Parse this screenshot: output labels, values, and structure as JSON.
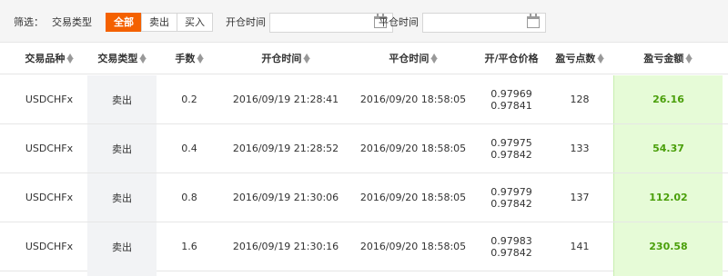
{
  "filter": {
    "label": "筛选：",
    "type_label": "交易类型",
    "type_options": [
      "全部",
      "卖出",
      "买入"
    ],
    "open_time_label": "开仓时间",
    "open_time_value": "",
    "close_time_label": "平仓时间",
    "close_time_value": "",
    "calendar_icon": "calendar-icon"
  },
  "table": {
    "headers": [
      "交易品种",
      "交易类型",
      "手数",
      "开仓时间",
      "平仓时间",
      "开/平仓价格",
      "盈亏点数",
      "盈亏金额"
    ],
    "sort_icon": "sort-icon",
    "rows": [
      {
        "symbol": "USDCHFx",
        "type": "卖出",
        "lots": "0.2",
        "open_time": "2016/09/19 21:28:41",
        "close_time": "2016/09/20 18:58:05",
        "open_price": "0.97969",
        "close_price": "0.97841",
        "points": "128",
        "amount": "26.16"
      },
      {
        "symbol": "USDCHFx",
        "type": "卖出",
        "lots": "0.4",
        "open_time": "2016/09/19 21:28:52",
        "close_time": "2016/09/20 18:58:05",
        "open_price": "0.97975",
        "close_price": "0.97842",
        "points": "133",
        "amount": "54.37"
      },
      {
        "symbol": "USDCHFx",
        "type": "卖出",
        "lots": "0.8",
        "open_time": "2016/09/19 21:30:06",
        "close_time": "2016/09/20 18:58:05",
        "open_price": "0.97979",
        "close_price": "0.97842",
        "points": "137",
        "amount": "112.02"
      },
      {
        "symbol": "USDCHFx",
        "type": "卖出",
        "lots": "1.6",
        "open_time": "2016/09/19 21:30:16",
        "close_time": "2016/09/20 18:58:05",
        "open_price": "0.97983",
        "close_price": "0.97842",
        "points": "141",
        "amount": "230.58"
      }
    ]
  },
  "colors": {
    "accent": "#f46100",
    "profit_text": "#4a9f0a",
    "profit_bg": "#e6fbd7",
    "type_bg": "#f2f3f5"
  }
}
